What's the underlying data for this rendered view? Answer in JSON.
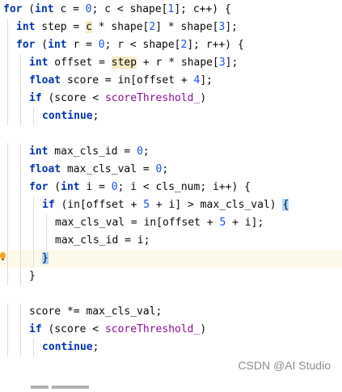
{
  "editor": {
    "lines": [
      {
        "indent": 0,
        "tokens": [
          {
            "t": "for",
            "c": "kw"
          },
          {
            "t": " ("
          },
          {
            "t": "int",
            "c": "kw"
          },
          {
            "t": " c = "
          },
          {
            "t": "0",
            "c": "num"
          },
          {
            "t": "; c < shape["
          },
          {
            "t": "1",
            "c": "num"
          },
          {
            "t": "]; c++) {"
          }
        ]
      },
      {
        "indent": 1,
        "tokens": [
          {
            "t": "int",
            "c": "kw"
          },
          {
            "t": " step = "
          },
          {
            "t": "c",
            "c": "hl"
          },
          {
            "t": " * shape["
          },
          {
            "t": "2",
            "c": "num"
          },
          {
            "t": "] * shape["
          },
          {
            "t": "3",
            "c": "num"
          },
          {
            "t": "];"
          }
        ]
      },
      {
        "indent": 1,
        "tokens": [
          {
            "t": "for",
            "c": "kw"
          },
          {
            "t": " ("
          },
          {
            "t": "int",
            "c": "kw"
          },
          {
            "t": " r = "
          },
          {
            "t": "0",
            "c": "num"
          },
          {
            "t": "; r < shape["
          },
          {
            "t": "2",
            "c": "num"
          },
          {
            "t": "]; r++) {"
          }
        ]
      },
      {
        "indent": 2,
        "tokens": [
          {
            "t": "int",
            "c": "kw"
          },
          {
            "t": " offset = "
          },
          {
            "t": "step",
            "c": "hl"
          },
          {
            "t": " + r * shape["
          },
          {
            "t": "3",
            "c": "num"
          },
          {
            "t": "];"
          }
        ]
      },
      {
        "indent": 2,
        "tokens": [
          {
            "t": "float",
            "c": "kw"
          },
          {
            "t": " score = in[offset + "
          },
          {
            "t": "4",
            "c": "num"
          },
          {
            "t": "];"
          }
        ]
      },
      {
        "indent": 2,
        "tokens": [
          {
            "t": "if",
            "c": "kw"
          },
          {
            "t": " (score < "
          },
          {
            "t": "scoreThreshold_",
            "c": "fld"
          },
          {
            "t": ")"
          }
        ]
      },
      {
        "indent": 3,
        "tokens": [
          {
            "t": "continue",
            "c": "kw"
          },
          {
            "t": ";"
          }
        ]
      },
      {
        "indent": 0,
        "tokens": []
      },
      {
        "indent": 2,
        "tokens": [
          {
            "t": "int",
            "c": "kw"
          },
          {
            "t": " max_cls_id = "
          },
          {
            "t": "0",
            "c": "num"
          },
          {
            "t": ";"
          }
        ]
      },
      {
        "indent": 2,
        "tokens": [
          {
            "t": "float",
            "c": "kw"
          },
          {
            "t": " max_cls_val = "
          },
          {
            "t": "0",
            "c": "num"
          },
          {
            "t": ";"
          }
        ]
      },
      {
        "indent": 2,
        "tokens": [
          {
            "t": "for",
            "c": "kw"
          },
          {
            "t": " ("
          },
          {
            "t": "int",
            "c": "kw"
          },
          {
            "t": " i = "
          },
          {
            "t": "0",
            "c": "num"
          },
          {
            "t": "; i < cls_num; i++) {"
          }
        ]
      },
      {
        "indent": 3,
        "tokens": [
          {
            "t": "if",
            "c": "kw"
          },
          {
            "t": " (in[offset + "
          },
          {
            "t": "5",
            "c": "num"
          },
          {
            "t": " + i] > max_cls_val) "
          },
          {
            "t": "{",
            "c": "brace-hl"
          }
        ]
      },
      {
        "indent": 4,
        "tokens": [
          {
            "t": "max_cls_val = in[offset + "
          },
          {
            "t": "5",
            "c": "num"
          },
          {
            "t": " + i];"
          }
        ]
      },
      {
        "indent": 4,
        "tokens": [
          {
            "t": "max_cls_id = i;"
          }
        ]
      },
      {
        "indent": 3,
        "current": true,
        "tokens": [
          {
            "t": "}",
            "c": "brace-hl"
          }
        ]
      },
      {
        "indent": 2,
        "tokens": [
          {
            "t": "}"
          }
        ]
      },
      {
        "indent": 0,
        "tokens": []
      },
      {
        "indent": 2,
        "tokens": [
          {
            "t": "score *= max_cls_val;"
          }
        ]
      },
      {
        "indent": 2,
        "tokens": [
          {
            "t": "if",
            "c": "kw"
          },
          {
            "t": " (score < "
          },
          {
            "t": "scoreThreshold_",
            "c": "fld"
          },
          {
            "t": ")"
          }
        ]
      },
      {
        "indent": 3,
        "tokens": [
          {
            "t": "continue",
            "c": "kw"
          },
          {
            "t": ";"
          }
        ]
      }
    ],
    "gutter_icon": "lightbulb-icon"
  },
  "watermark": "CSDN @AI Studio",
  "colors": {
    "keyword": "#0033b3",
    "number": "#1750eb",
    "field": "#871094",
    "usage_highlight": "#f7ebc3",
    "brace_match": "#a8d4ff",
    "current_line": "#fdf9e8"
  }
}
